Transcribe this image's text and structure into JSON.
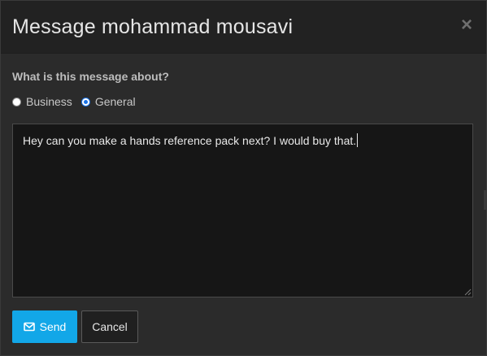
{
  "dialog": {
    "title": "Message mohammad mousavi",
    "close_label": "×"
  },
  "form": {
    "question": "What is this message about?",
    "options": [
      {
        "label": "Business",
        "selected": false
      },
      {
        "label": "General",
        "selected": true
      }
    ],
    "message_value": "Hey can you make a hands reference pack next? I would buy that."
  },
  "buttons": {
    "send_label": "Send",
    "cancel_label": "Cancel"
  },
  "icons": {
    "close": "close-icon",
    "send": "envelope-icon",
    "resize": "resize-grip-icon"
  },
  "colors": {
    "header_bg": "#222222",
    "body_bg": "#2b2b2b",
    "textarea_bg": "#161616",
    "accent": "#12a7e8",
    "radio_checked": "#1a73e8"
  }
}
